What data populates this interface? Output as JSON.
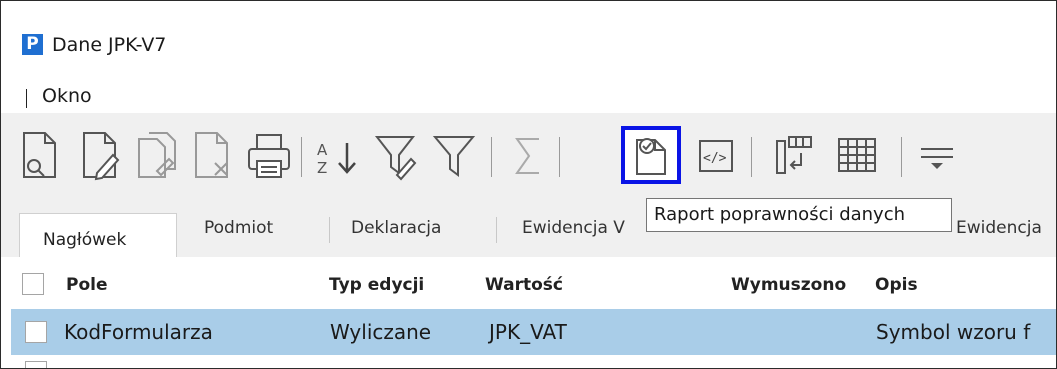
{
  "window": {
    "title": "Dane JPK-V7",
    "logo_letter": "P"
  },
  "menu": {
    "items": [
      "Okno"
    ]
  },
  "toolbar": {
    "active_button_tooltip": "Raport poprawności danych"
  },
  "tabs": [
    "Nagłówek",
    "Podmiot",
    "Deklaracja",
    "Ewidencja V",
    "Ewidencja"
  ],
  "grid": {
    "columns": [
      "Pole",
      "Typ edycji",
      "Wartość",
      "Wymuszono",
      "Opis"
    ],
    "rows": [
      {
        "pole": "KodFormularza",
        "typ_edycji": "Wyliczane",
        "wartosc": "JPK_VAT",
        "opis": "Symbol wzoru f"
      }
    ]
  },
  "colors": {
    "selection": "#a9cde8",
    "highlight_border": "#0a14e6",
    "logo": "#1f6fd1"
  }
}
